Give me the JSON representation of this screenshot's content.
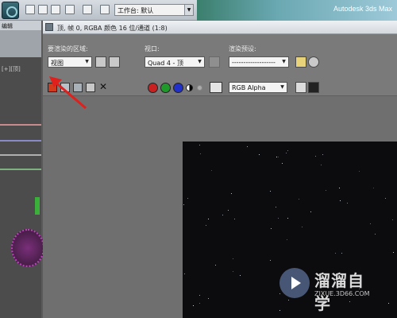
{
  "app": {
    "title": "Autodesk 3ds Max",
    "workspace_label": "工作台: 默认",
    "menu_fragment": "编辑"
  },
  "frame_window": {
    "title": "顶, 帧 0, RGBA 颜色 16 位/通道 (1:8)",
    "area_to_render": {
      "label": "要渲染的区域:",
      "value": "视图"
    },
    "viewport": {
      "label": "视口:",
      "value": "Quad 4 - 顶"
    },
    "render_preset": {
      "label": "渲染预设:",
      "value": "-------------------"
    },
    "channel": {
      "value": "RGB Alpha"
    }
  },
  "left_strip": {
    "viewport_label": "[+][顶]"
  },
  "channels": {
    "red": "#c82020",
    "green": "#1f9a2a",
    "blue": "#2030c8"
  },
  "watermark": {
    "name": "溜溜自学",
    "url": "ZIXUE.3D66.COM"
  }
}
